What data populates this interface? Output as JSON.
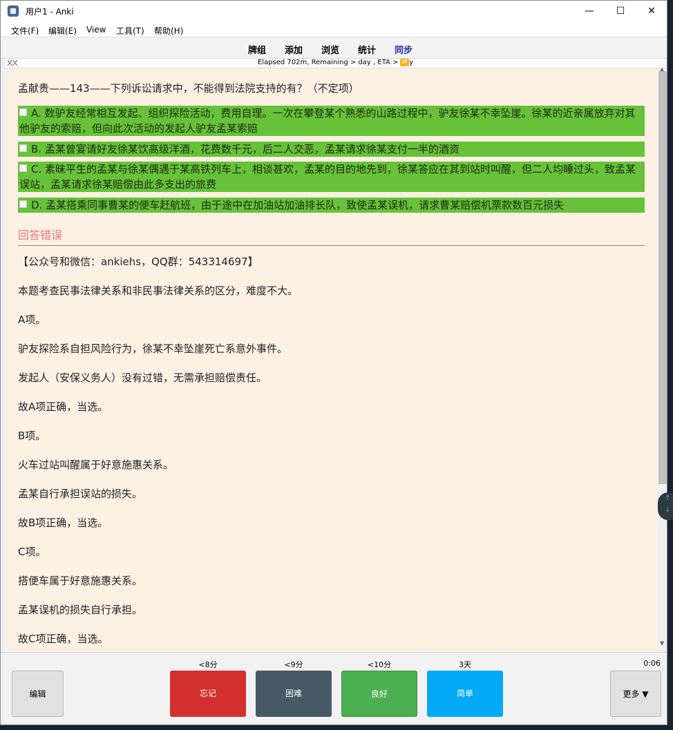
{
  "window": {
    "title": "用户1 - Anki",
    "controls": {
      "minimize": "—",
      "maximize": "☐",
      "close": "✕"
    }
  },
  "menu": {
    "items": [
      "文件(F)",
      "编辑(E)",
      "View",
      "工具(T)",
      "帮助(H)"
    ]
  },
  "toolbar": {
    "items": [
      "牌组",
      "添加",
      "浏览",
      "统计",
      "同步"
    ]
  },
  "status": {
    "marker": "XX",
    "elapsed": "Elapsed 702m, Remaining > day , ETA > day",
    "icon_glyph": "⇄"
  },
  "card": {
    "question": "孟献贵——143——下列诉讼请求中，不能得到法院支持的有？（不定项）",
    "options": [
      "A. 数驴友经常相互发起、组织探险活动，费用自理。一次在攀登某个熟悉的山路过程中，驴友徐某不幸坠崖。徐某的近亲属放弃对其他驴友的索赔，但向此次活动的发起人驴友孟某索赔",
      "B. 孟某曾宴请好友徐某饮高级洋酒，花费数千元，后二人交恶，孟某请求徐某支付一半的酒资",
      "C. 素昧平生的孟某与徐某偶遇于某高铁列车上，相谈甚欢，孟某的目的地先到，徐某答应在其到站时叫醒，但二人均睡过头，致孟某误站，孟某请求徐某赔偿由此多支出的旅费",
      "D. 孟某搭乘同事曹某的便车赶航班，由于途中在加油站加油排长队，致使孟某误机，请求曹某赔偿机票款数百元损失"
    ],
    "result": "回答错误",
    "explanation": [
      "【公众号和微信：ankiehs，QQ群：543314697】",
      "本题考查民事法律关系和非民事法律关系的区分，难度不大。",
      "A项。",
      "驴友探险系自担风险行为，徐某不幸坠崖死亡系意外事件。",
      "发起人（安保义务人）没有过错，无需承担赔偿责任。",
      "故A项正确，当选。",
      "B项。",
      "火车过站叫醒属于好意施惠关系。",
      "孟某自行承担误站的损失。",
      "故B项正确，当选。",
      "C项。",
      "搭便车属于好意施惠关系。",
      "孟某误机的损失自行承担。",
      "故C项正确，当选。"
    ]
  },
  "bottom": {
    "edit_label": "编辑",
    "more_label": "更多 ▼",
    "timer": "0:06",
    "answers": [
      {
        "label": "忘记",
        "interval": "<8分",
        "color": "#d32f2f"
      },
      {
        "label": "困难",
        "interval": "<9分",
        "color": "#455a64"
      },
      {
        "label": "良好",
        "interval": "<10分",
        "color": "#4caf50"
      },
      {
        "label": "简单",
        "interval": "3天",
        "color": "#03a9f4"
      }
    ]
  }
}
